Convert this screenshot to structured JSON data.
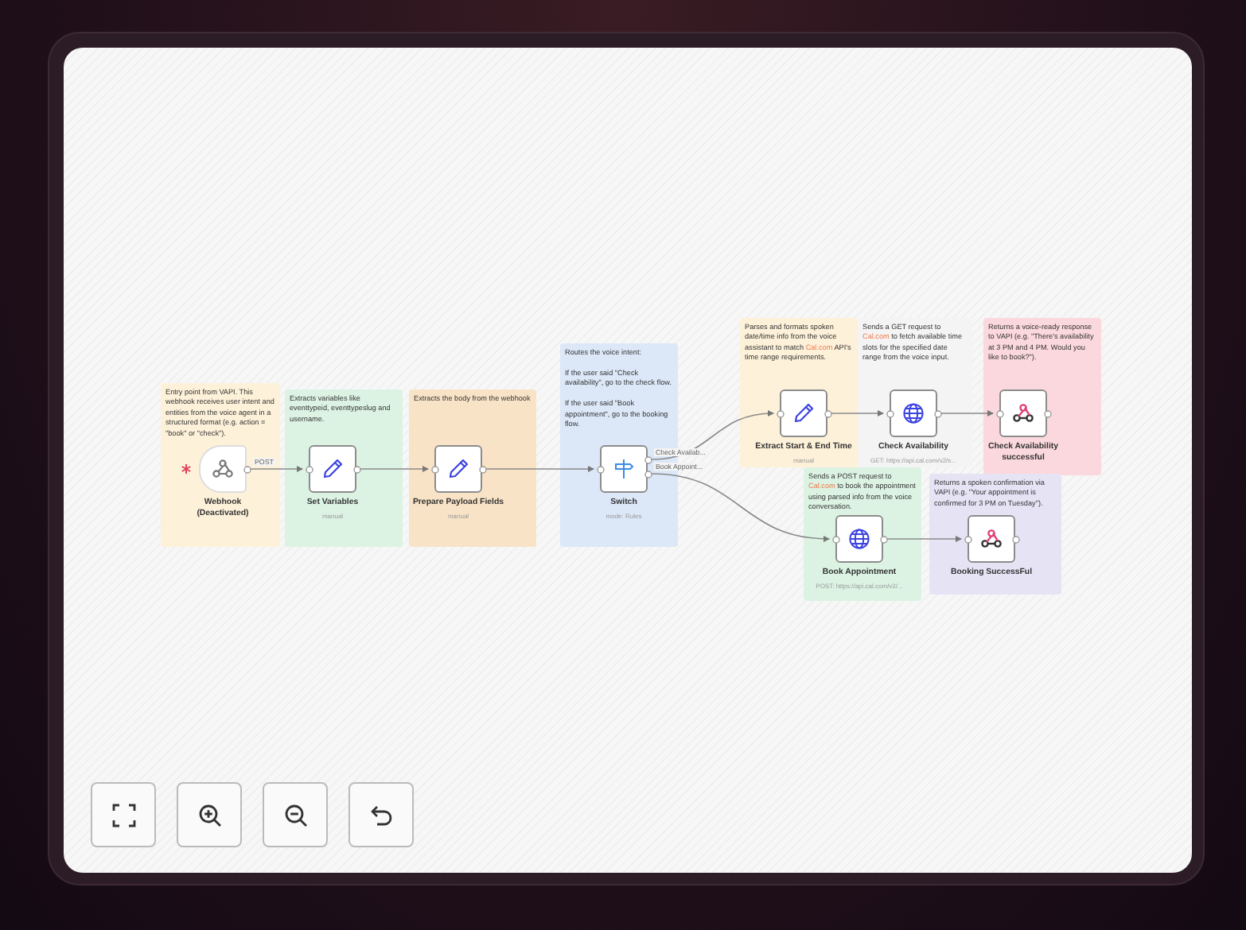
{
  "notes": [
    {
      "color": "#fdf1d9",
      "text": [
        {
          "t": "Entry point from VAPI. This webhook receives user intent and entities from the voice agent in a structured format (e.g. action = \"book\" or \"check\")."
        }
      ]
    },
    {
      "color": "#dcf3e3",
      "text": [
        {
          "t": "Extracts variables like eventtypeid, eventtypeslug and username."
        }
      ]
    },
    {
      "color": "#f8e3c6",
      "text": [
        {
          "t": "Extracts the body from the webhook"
        }
      ]
    },
    {
      "color": "#dce8f8",
      "text": [
        {
          "t": "Routes the voice intent:\n\nIf the user said \"Check availability\", go to the check flow.\n\nIf the user said \"Book appointment\", go to the booking flow."
        }
      ]
    },
    {
      "color": "#fdf1d9",
      "text": [
        {
          "t": "Parses and formats spoken date/time info from the voice assistant to match "
        },
        {
          "t": "Cal.com",
          "kind": "link"
        },
        {
          "t": " API's time range requirements."
        }
      ]
    },
    {
      "color": "#f4f4f4",
      "text": [
        {
          "t": "Sends a GET request to "
        },
        {
          "t": "Cal.com",
          "kind": "link"
        },
        {
          "t": " to fetch available time slots for the specified date range from the voice input."
        }
      ]
    },
    {
      "color": "#fbd8dd",
      "text": [
        {
          "t": "Returns a voice-ready response to VAPI (e.g. \"There's availability at 3 PM and 4 PM. Would you like to book?\")."
        }
      ]
    },
    {
      "color": "#dcf3e3",
      "text": [
        {
          "t": "Sends a POST request to "
        },
        {
          "t": "Cal.com",
          "kind": "link"
        },
        {
          "t": " to book the appointment using parsed info from the voice conversation."
        }
      ]
    },
    {
      "color": "#e6e3f5",
      "text": [
        {
          "t": "Returns a spoken confirmation via VAPI (e.g. \"Your appointment is confirmed for 3 PM on Tuesday\")."
        }
      ]
    }
  ],
  "nodes": [
    {
      "kind": "trigger",
      "title": "Webhook (Deactivated)",
      "outputs": [
        "POST"
      ]
    },
    {
      "kind": "action",
      "title": "Set Variables",
      "subtitle": "manual"
    },
    {
      "kind": "action",
      "title": "Prepare Payload Fields",
      "subtitle": "manual"
    },
    {
      "kind": "action",
      "title": "Switch",
      "subtitle": "mode: Rules",
      "outputs": [
        "Check Availab...",
        "Book Appoint..."
      ]
    },
    {
      "kind": "action",
      "title": "Extract Start & End Time",
      "subtitle": "manual"
    },
    {
      "kind": "action",
      "title": "Check Availability",
      "subtitle": "GET: https://api.cal.com/v2/s..."
    },
    {
      "kind": "action",
      "title": "Check Availability successful"
    },
    {
      "kind": "action",
      "title": "Book Appointment",
      "subtitle": "POST: https://api.cal.com/v2/..."
    },
    {
      "kind": "action",
      "title": "Booking SuccessFul"
    }
  ],
  "controls": [
    {
      "kind": "fit"
    },
    {
      "kind": "zoom-in"
    },
    {
      "kind": "zoom-out"
    },
    {
      "kind": "undo"
    }
  ]
}
